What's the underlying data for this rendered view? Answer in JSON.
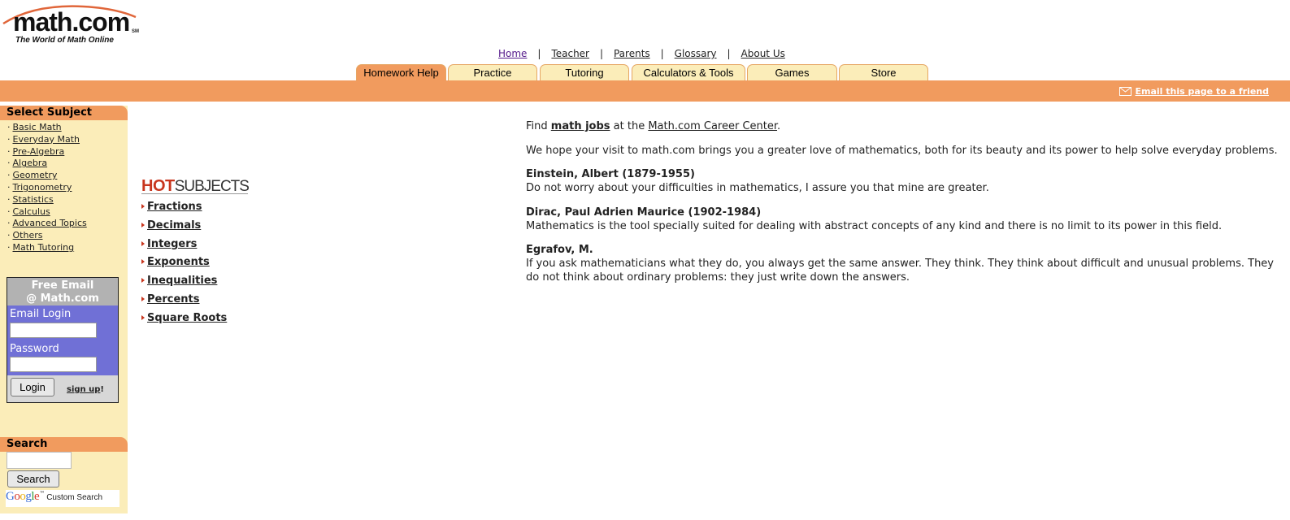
{
  "logo": {
    "word": "math.com",
    "tagline": "The World of Math Online",
    "sm": "SM"
  },
  "topnav": [
    {
      "label": "Home"
    },
    {
      "label": "Teacher"
    },
    {
      "label": "Parents"
    },
    {
      "label": "Glossary"
    },
    {
      "label": "About Us"
    }
  ],
  "topnav_separator": "|",
  "tabs": [
    {
      "label": "Homework Help",
      "active": true
    },
    {
      "label": "Practice"
    },
    {
      "label": "Tutoring"
    },
    {
      "label": "Calculators & Tools"
    },
    {
      "label": "Games"
    },
    {
      "label": "Store"
    }
  ],
  "email_friend": "Email this page to a friend",
  "sidebar": {
    "select_subject": "Select Subject",
    "bullet": "·",
    "subjects": [
      "Basic Math",
      "Everyday Math",
      "Pre-Algebra",
      "Algebra",
      "Geometry",
      "Trigonometry",
      "Statistics",
      "Calculus",
      "Advanced Topics",
      "Others",
      "Math Tutoring"
    ],
    "email_box": {
      "header_line1": "Free Email",
      "header_line2": "@ Math.com",
      "login_label": "Email Login",
      "password_label": "Password",
      "login_button": "Login",
      "signup_link": "sign up",
      "signup_suffix": "!"
    },
    "search": {
      "heading": "Search",
      "button": "Search",
      "google_label": "Google",
      "tm": "™",
      "custom_search": "Custom Search"
    }
  },
  "hot_subjects": {
    "title_bold": "HOT",
    "title_rest": "SUBJECTS",
    "items": [
      "Fractions",
      "Decimals",
      "Integers",
      "Exponents",
      "Inequalities",
      "Percents",
      "Square Roots"
    ]
  },
  "main": {
    "career": {
      "find": "Find",
      "math_jobs": "math jobs",
      "at_the": "at the",
      "career_center": "Math.com Career Center",
      "period": "."
    },
    "hope": "We hope your visit to math.com brings you a greater love of mathematics, both for its beauty and its power to help solve everyday problems.",
    "quotes": [
      {
        "author": "Einstein, Albert (1879-1955)",
        "text": "Do not worry about your difficulties in mathematics, I assure you that mine are greater."
      },
      {
        "author": "Dirac, Paul Adrien Maurice (1902-1984)",
        "text": "Mathematics is the tool specially suited for dealing with abstract concepts of any kind and there is no limit to its power in this field."
      },
      {
        "author": "Egrafov, M.",
        "text": "If you ask mathematicians what they do, you always get the same answer. They think. They think about difficult and unusual problems. They do not think about ordinary problems: they just write down the answers."
      }
    ]
  },
  "colors": {
    "orange": "#f19b5e",
    "cream": "#fbedb9",
    "email_blue": "#7070d6",
    "hot_red": "#c8361e"
  }
}
